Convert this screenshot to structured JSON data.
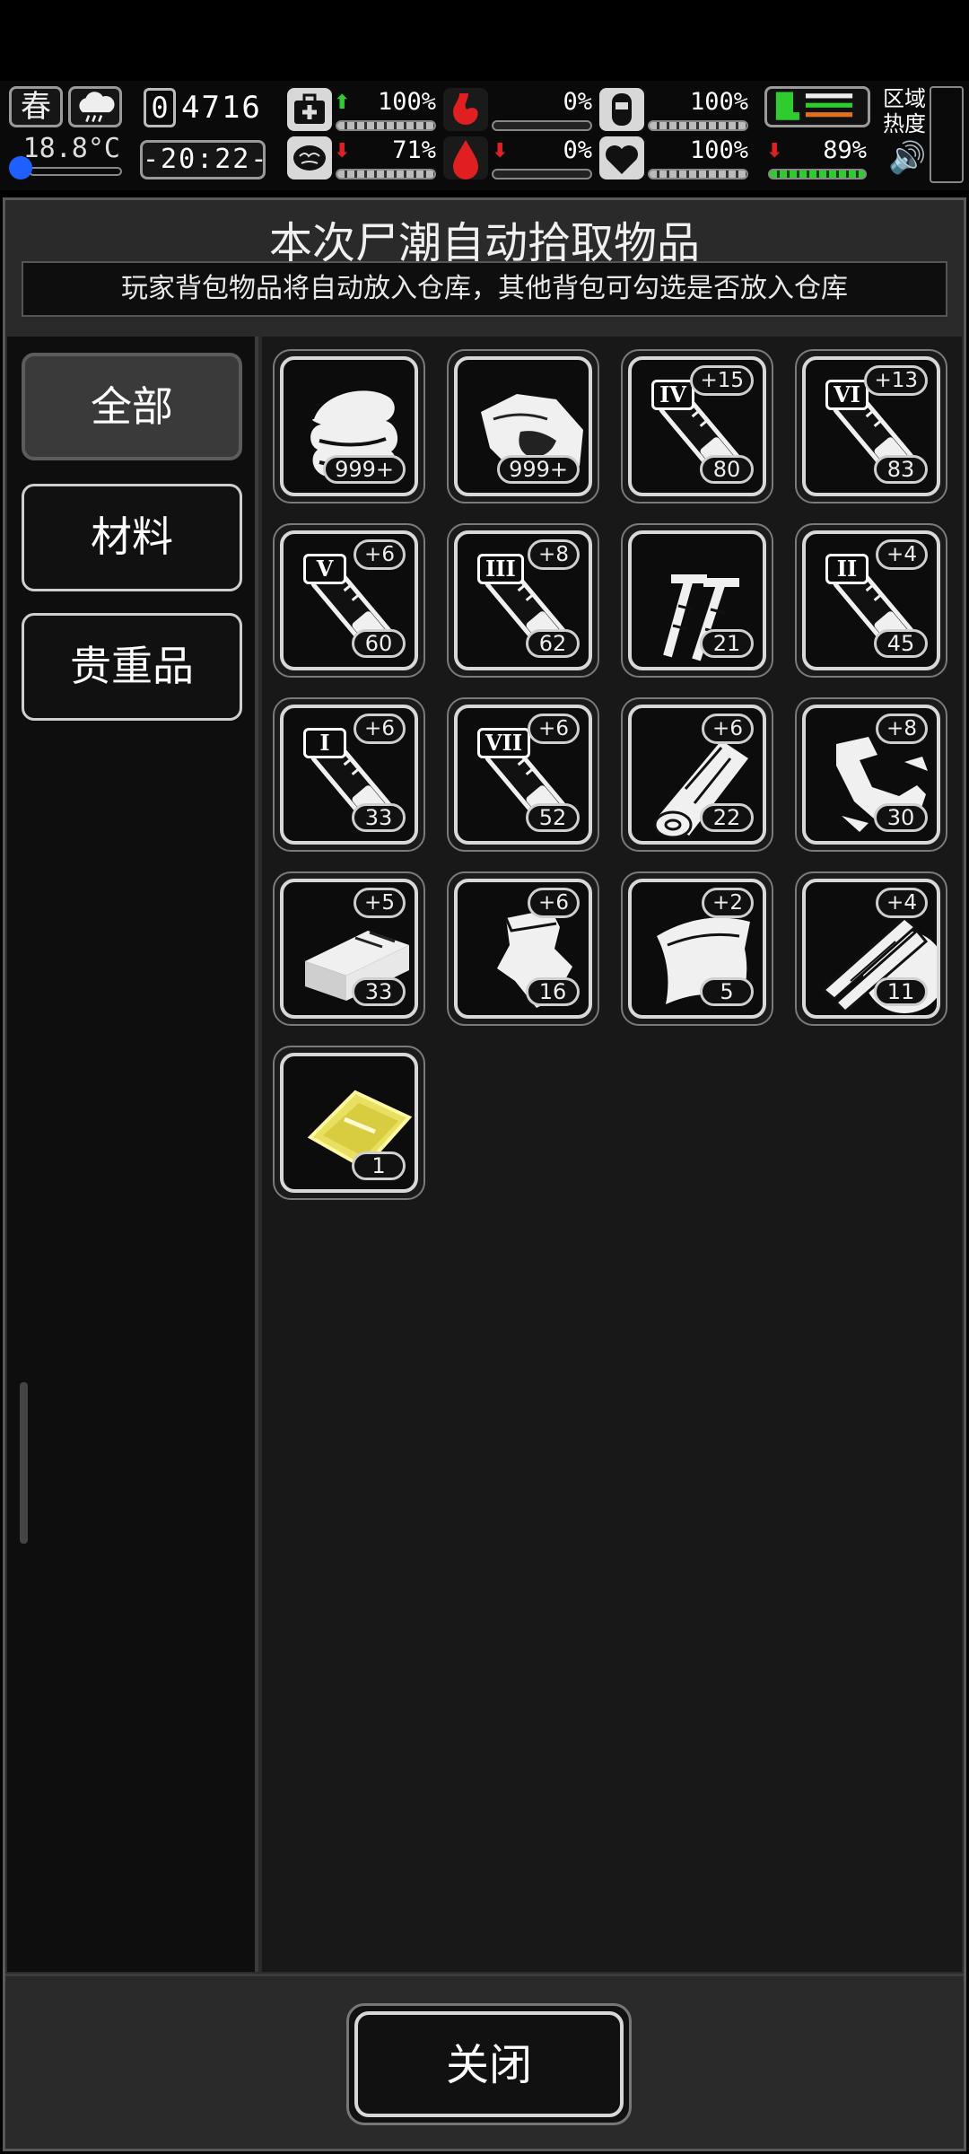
{
  "hud": {
    "season": "春",
    "temperature": "18.8°C",
    "day_prefix": "0",
    "day_number": "4716",
    "time": "-20:22-",
    "stats": [
      {
        "name": "health",
        "arrow": "up",
        "value": "100%",
        "fill": 1.0
      },
      {
        "name": "hunger",
        "arrow": "",
        "value": "0%",
        "fill": 0.0
      },
      {
        "name": "hydration",
        "arrow": "",
        "value": "100%",
        "fill": 1.0
      },
      {
        "name": "sanity",
        "arrow": "down",
        "value": "71%",
        "fill": 0.71
      },
      {
        "name": "bleeding",
        "arrow": "down",
        "value": "0%",
        "fill": 0.0
      },
      {
        "name": "mood",
        "arrow": "",
        "value": "100%",
        "fill": 1.0
      },
      {
        "name": "stamina",
        "arrow": "down",
        "value": "89%",
        "fill": 0.89
      }
    ],
    "region_label_1": "区域",
    "region_label_2": "热度"
  },
  "dialog": {
    "title": "本次尸潮自动拾取物品",
    "subtitle": "玩家背包物品将自动放入仓库，其他背包可勾选是否放入仓库",
    "categories": [
      {
        "label": "全部",
        "active": true
      },
      {
        "label": "材料",
        "active": false
      },
      {
        "label": "贵重品",
        "active": false
      }
    ],
    "items": [
      {
        "icon": "cloth-icon",
        "plus": "",
        "roman": "",
        "qty": "999+"
      },
      {
        "icon": "meat-icon",
        "plus": "",
        "roman": "",
        "qty": "999+"
      },
      {
        "icon": "syringe-icon",
        "plus": "+15",
        "roman": "IV",
        "qty": "80"
      },
      {
        "icon": "syringe-icon",
        "plus": "+13",
        "roman": "VI",
        "qty": "83"
      },
      {
        "icon": "syringe-icon",
        "plus": "+6",
        "roman": "V",
        "qty": "60"
      },
      {
        "icon": "syringe-icon",
        "plus": "+8",
        "roman": "III",
        "qty": "62"
      },
      {
        "icon": "screws-icon",
        "plus": "",
        "roman": "",
        "qty": "21"
      },
      {
        "icon": "syringe-icon",
        "plus": "+4",
        "roman": "II",
        "qty": "45"
      },
      {
        "icon": "syringe-icon",
        "plus": "+6",
        "roman": "I",
        "qty": "33"
      },
      {
        "icon": "syringe-icon",
        "plus": "+6",
        "roman": "VII",
        "qty": "52"
      },
      {
        "icon": "wood-log-icon",
        "plus": "+6",
        "roman": "",
        "qty": "22"
      },
      {
        "icon": "scrap-metal-icon",
        "plus": "+8",
        "roman": "",
        "qty": "30"
      },
      {
        "icon": "brick-icon",
        "plus": "+5",
        "roman": "",
        "qty": "33"
      },
      {
        "icon": "pouch-icon",
        "plus": "+6",
        "roman": "",
        "qty": "16"
      },
      {
        "icon": "leather-icon",
        "plus": "+2",
        "roman": "",
        "qty": "5"
      },
      {
        "icon": "wood-planks-icon",
        "plus": "+4",
        "roman": "",
        "qty": "11"
      },
      {
        "icon": "gold-plate-icon",
        "plus": "",
        "roman": "",
        "qty": "1"
      }
    ],
    "close_label": "关闭"
  },
  "colors": {
    "accent_green": "#2ecc2e",
    "warning_red": "#e02020",
    "gold": "#e8e060"
  }
}
